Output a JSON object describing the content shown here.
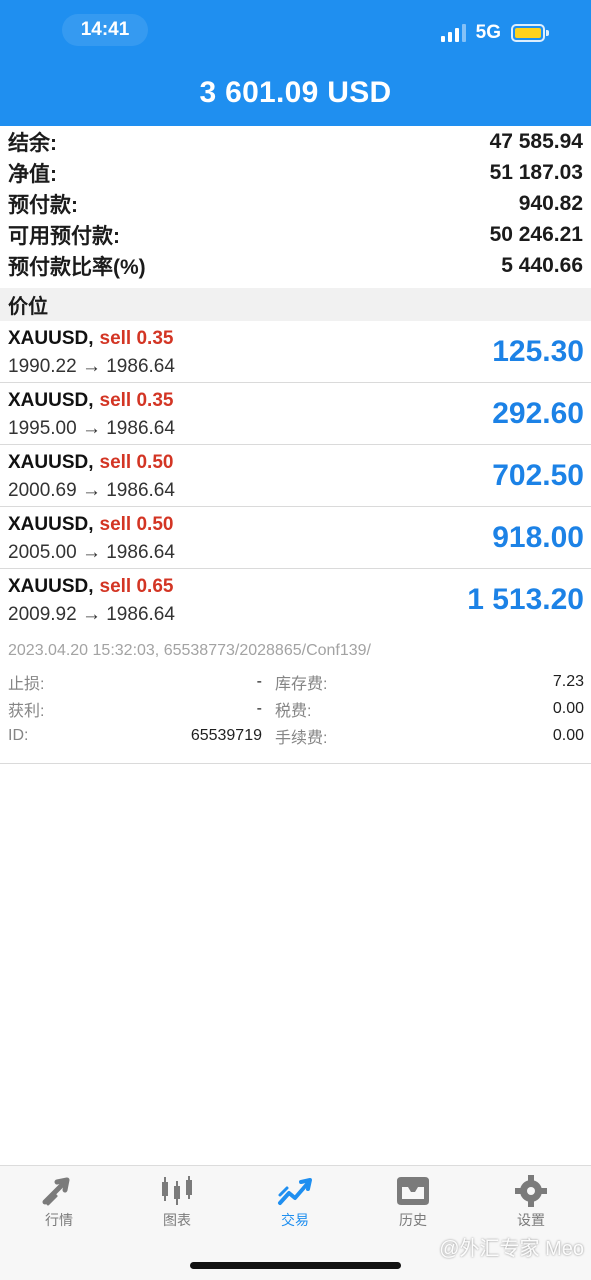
{
  "status": {
    "time": "14:41",
    "network": "5G"
  },
  "header": {
    "balance_title": "3 601.09 USD"
  },
  "summary": [
    {
      "label": "结余:",
      "value": "47 585.94"
    },
    {
      "label": "净值:",
      "value": "51 187.03"
    },
    {
      "label": "预付款:",
      "value": "940.82"
    },
    {
      "label": "可用预付款:",
      "value": "50 246.21"
    },
    {
      "label": "预付款比率(%)",
      "value": "5 440.66"
    }
  ],
  "positions_header": "价位",
  "positions": [
    {
      "symbol": "XAUUSD,",
      "side": "sell 0.35",
      "prices": "1990.22 → 1986.64",
      "profit": "125.30"
    },
    {
      "symbol": "XAUUSD,",
      "side": "sell 0.35",
      "prices": "1995.00 → 1986.64",
      "profit": "292.60"
    },
    {
      "symbol": "XAUUSD,",
      "side": "sell 0.50",
      "prices": "2000.69 → 1986.64",
      "profit": "702.50"
    },
    {
      "symbol": "XAUUSD,",
      "side": "sell 0.50",
      "prices": "2005.00 → 1986.64",
      "profit": "918.00"
    },
    {
      "symbol": "XAUUSD,",
      "side": "sell 0.65",
      "prices": "2009.92 → 1986.64",
      "profit": "1 513.20"
    }
  ],
  "details": {
    "meta": "2023.04.20 15:32:03, 65538773/2028865/Conf139/",
    "left": [
      {
        "label": "止损:",
        "value": "-"
      },
      {
        "label": "获利:",
        "value": "-"
      },
      {
        "label": "ID:",
        "value": "65539719"
      }
    ],
    "right": [
      {
        "label": "库存费:",
        "value": "7.23"
      },
      {
        "label": "税费:",
        "value": "0.00"
      },
      {
        "label": "手续费:",
        "value": "0.00"
      }
    ]
  },
  "nav": {
    "items": [
      {
        "label": "行情",
        "icon": "arrows-icon"
      },
      {
        "label": "图表",
        "icon": "candlestick-icon"
      },
      {
        "label": "交易",
        "icon": "trend-icon"
      },
      {
        "label": "历史",
        "icon": "inbox-icon"
      },
      {
        "label": "设置",
        "icon": "gear-icon"
      }
    ],
    "active": "交易",
    "active_color": "#1f8ff0"
  },
  "watermark": "@外汇专家 Meo",
  "colors": {
    "header": "#1f8ff0",
    "sell": "#d33524",
    "profit": "#1c82e6"
  }
}
